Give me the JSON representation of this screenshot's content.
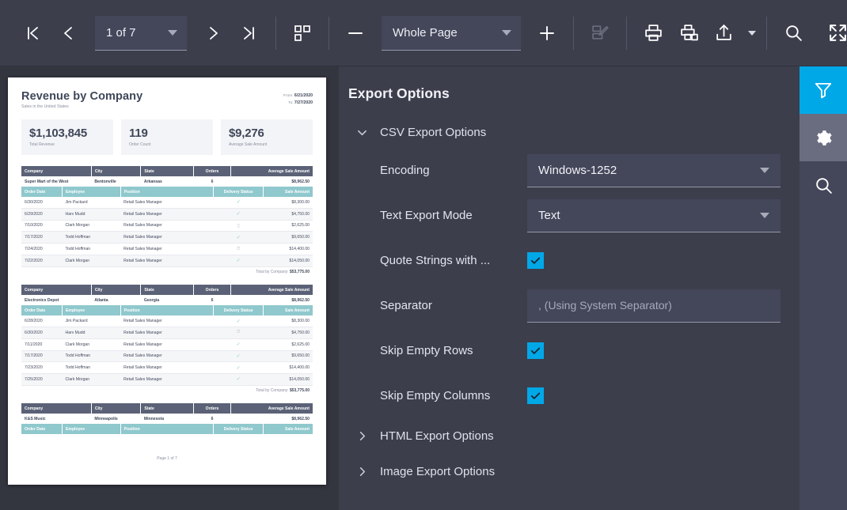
{
  "toolbar": {
    "first_page_label": "first-page",
    "prev_page_label": "previous-page",
    "page_selector_value": "1 of 7",
    "next_page_label": "next-page",
    "last_page_label": "last-page",
    "thumbnails_label": "multipage-view",
    "zoom_out_label": "−",
    "zoom_value": "Whole Page",
    "zoom_in_label": "+",
    "edit_label": "edit-report",
    "print_label": "print",
    "print_page_label": "print-current-page",
    "export_label": "export",
    "search_label": "search",
    "fullscreen_label": "fullscreen"
  },
  "panel": {
    "title": "Export Options",
    "groups": [
      {
        "label": "CSV Export Options",
        "expanded": true
      },
      {
        "label": "HTML Export Options",
        "expanded": false
      },
      {
        "label": "Image Export Options",
        "expanded": false
      }
    ],
    "fields": {
      "encoding": {
        "label": "Encoding",
        "value": "Windows-1252"
      },
      "text_export_mode": {
        "label": "Text Export Mode",
        "value": "Text"
      },
      "quote_strings": {
        "label": "Quote Strings with ...",
        "checked": true
      },
      "separator": {
        "label": "Separator",
        "value": "",
        "placeholder": ", (Using System Separator)"
      },
      "skip_empty_rows": {
        "label": "Skip Empty Rows",
        "checked": true
      },
      "skip_empty_columns": {
        "label": "Skip Empty Columns",
        "checked": true
      }
    }
  },
  "rail": {
    "filter_label": "filter-panel",
    "settings_label": "export-settings-panel",
    "search_label": "search-panel"
  },
  "document": {
    "title": "Revenue by Company",
    "subtitle": "Sales in the United States",
    "from_label": "From:",
    "from_value": "6/21/2020",
    "to_label": "To:",
    "to_value": "7/27/2020",
    "kpis": [
      {
        "value": "$1,103,845",
        "label": "Total Revenue"
      },
      {
        "value": "119",
        "label": "Order Count"
      },
      {
        "value": "$9,276",
        "label": "Average Sale Amount"
      }
    ],
    "company_columns": [
      "Company",
      "City",
      "State",
      "Orders",
      "Average Sale Amount"
    ],
    "order_columns": [
      "Order Date",
      "Employee",
      "Position",
      "Delivery Status",
      "Sale Amount"
    ],
    "total_label": "Total by Company:",
    "blocks": [
      {
        "company": [
          "Super Mart of the West",
          "Bentonville",
          "Arkansas",
          "6",
          "$8,962.50"
        ],
        "orders": [
          [
            "6/30/2020",
            "Jim Packard",
            "Retail Sales Manager",
            "check",
            "$8,300.00"
          ],
          [
            "6/29/2020",
            "Harv Mudd",
            "Retail Sales Manager",
            "check",
            "$4,750.00"
          ],
          [
            "7/10/2020",
            "Clark Morgan",
            "Retail Sales Manager",
            "truck",
            "$2,625.00"
          ],
          [
            "7/17/2020",
            "Todd Hoffman",
            "Retail Sales Manager",
            "check",
            "$9,650.00"
          ],
          [
            "7/24/2020",
            "Todd Hoffman",
            "Retail Sales Manager",
            "clock",
            "$14,400.00"
          ],
          [
            "7/22/2020",
            "Clark Morgan",
            "Retail Sales Manager",
            "check",
            "$14,050.00"
          ]
        ],
        "total": "$53,775.00"
      },
      {
        "company": [
          "Electronics Depot",
          "Atlanta",
          "Georgia",
          "6",
          "$8,962.50"
        ],
        "orders": [
          [
            "6/28/2020",
            "Jim Packard",
            "Retail Sales Manager",
            "check",
            "$8,300.00"
          ],
          [
            "6/30/2020",
            "Harv Mudd",
            "Retail Sales Manager",
            "clock",
            "$4,750.00"
          ],
          [
            "7/11/2020",
            "Clark Morgan",
            "Retail Sales Manager",
            "check",
            "$2,625.00"
          ],
          [
            "7/17/2020",
            "Todd Hoffman",
            "Retail Sales Manager",
            "check",
            "$9,650.00"
          ],
          [
            "7/23/2020",
            "Todd Hoffman",
            "Retail Sales Manager",
            "check",
            "$14,400.00"
          ],
          [
            "7/25/2020",
            "Clark Morgan",
            "Retail Sales Manager",
            "check",
            "$14,050.00"
          ]
        ],
        "total": "$53,775.00"
      },
      {
        "company": [
          "K&S Music",
          "Minneapolis",
          "Minnesota",
          "6",
          "$8,962.50"
        ],
        "orders": [],
        "total": ""
      }
    ],
    "footer": "Page 1 of 7"
  },
  "colors": {
    "accent": "#00a8e8",
    "toolbar_bg": "#3c3e4c",
    "panel_bg": "#3c3e4c",
    "viewer_bg": "#33353f",
    "field_bg": "#44465a",
    "table_header_dark": "#5b6277",
    "table_header_teal": "#8fc8cd"
  }
}
